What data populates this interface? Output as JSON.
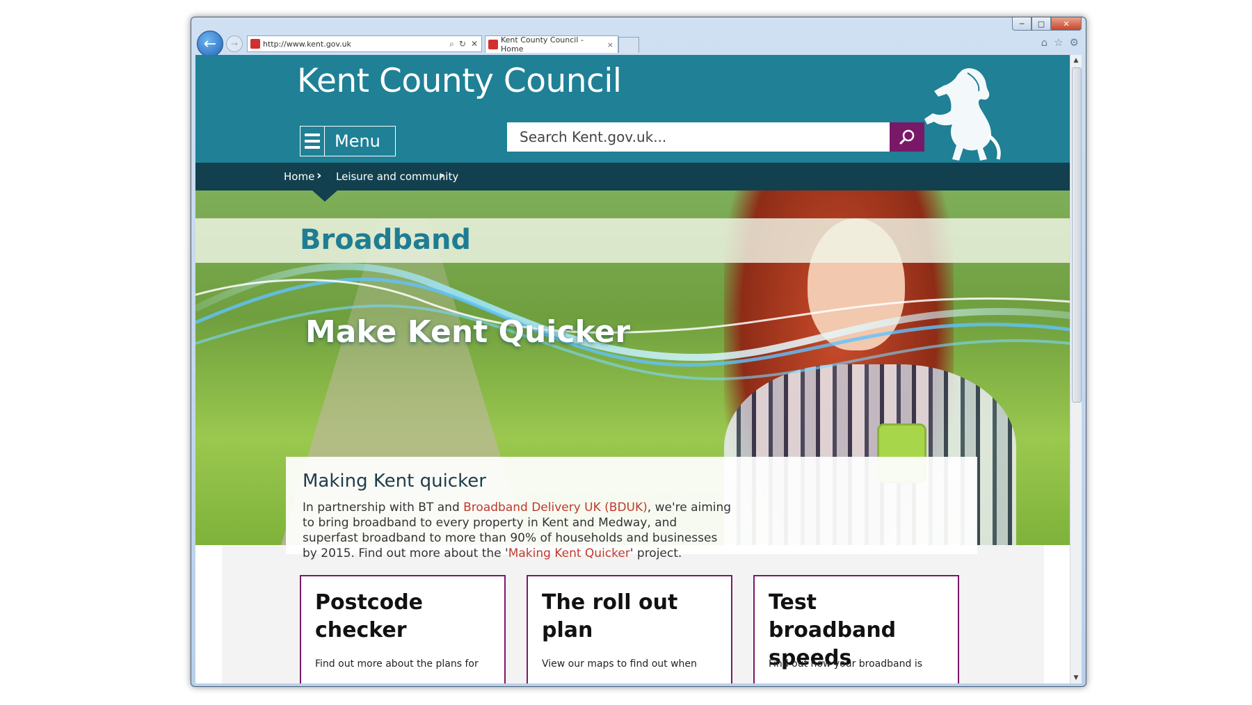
{
  "browser": {
    "url": "http://www.kent.gov.uk",
    "tab_title": "Kent County Council - Home",
    "tab_close": "×",
    "window_controls": {
      "minimize": "─",
      "maximize": "□",
      "close": "✕"
    },
    "icons": [
      "back-arrow-icon",
      "forward-arrow-icon",
      "search-icon",
      "refresh-icon",
      "stop-icon",
      "home-icon",
      "favorites-star-icon",
      "settings-gear-icon"
    ]
  },
  "header": {
    "site_title": "Kent County Council",
    "menu_label": "Menu",
    "search_placeholder": "Search Kent.gov.uk..."
  },
  "breadcrumb": {
    "items": [
      "Home",
      "Leisure and community"
    ]
  },
  "hero": {
    "page_title": "Broadband",
    "slogan": "Make Kent Quicker"
  },
  "intro": {
    "heading": "Making Kent quicker",
    "text_1": "In partnership with BT and ",
    "link_1": "Broadband Delivery UK (BDUK)",
    "text_2": ", we're aiming to bring broadband to every property in Kent and Medway, and superfast broadband to more than 90% of households and businesses by 2015. Find out more about the '",
    "link_2": "Making Kent Quicker",
    "text_3": "' project."
  },
  "cards": [
    {
      "title": "Postcode checker",
      "desc": "Find out more about the plans for"
    },
    {
      "title": "The roll out plan",
      "desc": "View our maps to find out when"
    },
    {
      "title": "Test broadband speeds",
      "desc": "Find out how your broadband is"
    }
  ],
  "colors": {
    "header_teal": "#1f8096",
    "breadcrumb_dark": "#12404e",
    "accent_purple": "#7a1868",
    "link_red": "#c0392b"
  }
}
